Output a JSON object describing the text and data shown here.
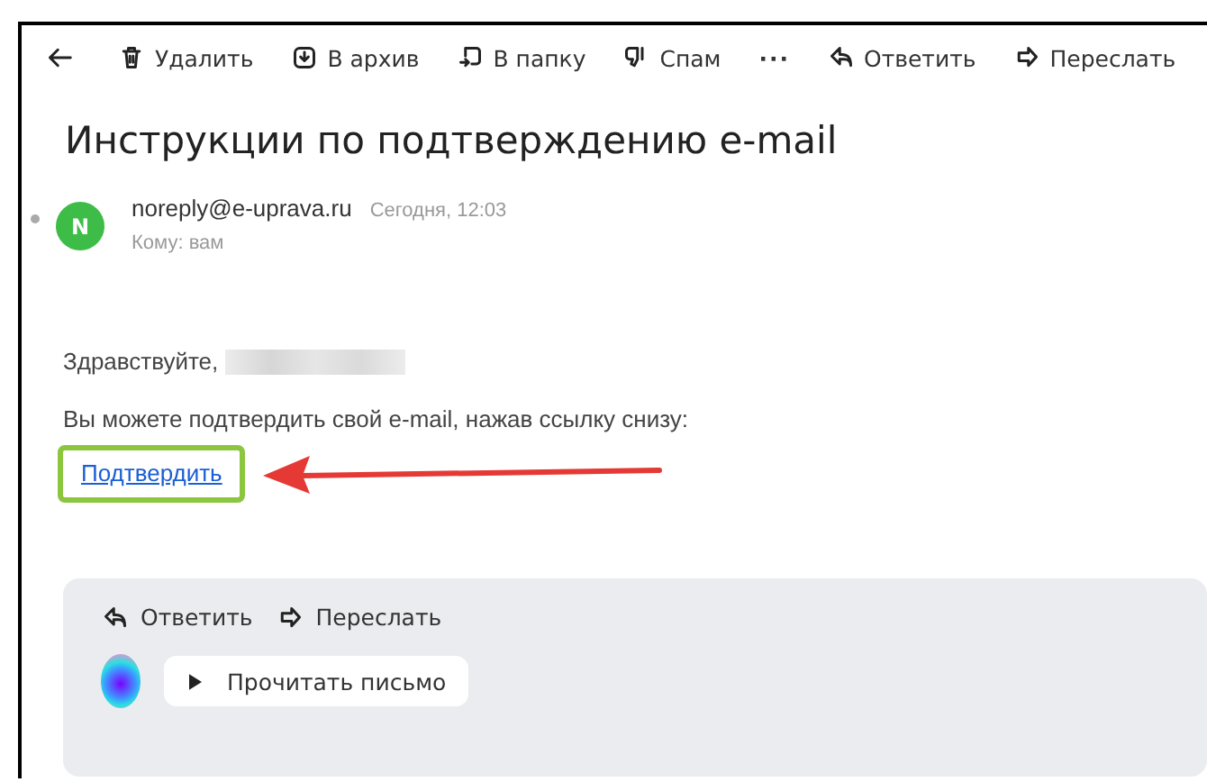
{
  "toolbar": [
    {
      "kind": "back"
    },
    {
      "kind": "delete",
      "label": "Удалить"
    },
    {
      "kind": "archive",
      "label": "В архив"
    },
    {
      "kind": "folder",
      "label": "В папку"
    },
    {
      "kind": "spam",
      "label": "Спам"
    },
    {
      "kind": "more",
      "label": "···"
    },
    {
      "kind": "reply",
      "label": "Ответить"
    },
    {
      "kind": "forward",
      "label": "Переслать"
    }
  ],
  "message": {
    "subject": "Инструкции по подтверждению e-mail",
    "unread": true,
    "sender": {
      "initial": "N",
      "address": "noreply@e-uprava.ru",
      "time": "Сегодня, 12:03",
      "to": "Кому: вам"
    },
    "greeting": "Здравствуйте,",
    "text": "Вы можете подтвердить свой e-mail, нажав ссылку снизу:",
    "link": "Подтвердить"
  },
  "quick_actions": [
    {
      "kind": "reply",
      "label": "Ответить"
    },
    {
      "kind": "forward",
      "label": "Переслать"
    }
  ],
  "read_button": {
    "label": "Прочитать письмо"
  }
}
